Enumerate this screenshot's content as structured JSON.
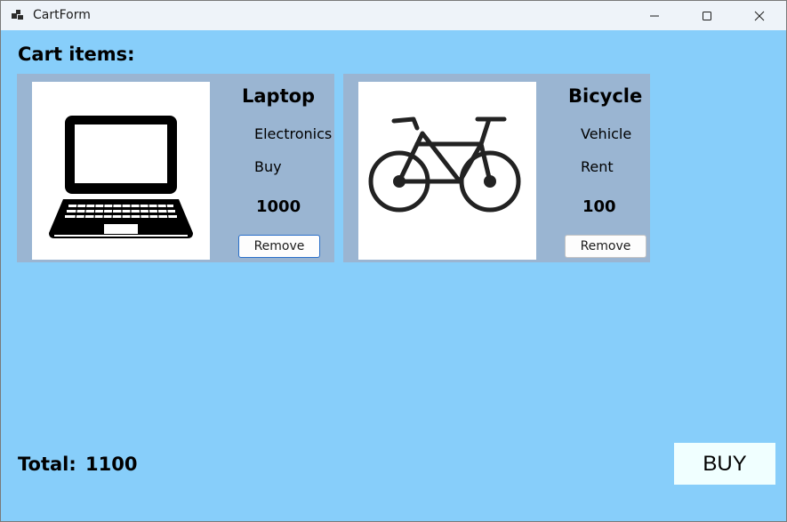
{
  "window": {
    "title": "CartForm",
    "icon": "app-form-icon",
    "controls": [
      "minimize-icon",
      "maximize-icon",
      "close-icon"
    ]
  },
  "cart": {
    "heading": "Cart items:",
    "items": [
      {
        "name": "Laptop",
        "category": "Electronics",
        "type": "Buy",
        "price": "1000",
        "image": "laptop-icon",
        "remove_label": "Remove"
      },
      {
        "name": "Bicycle",
        "category": "Vehicle",
        "type": "Rent",
        "price": "100",
        "image": "bicycle-icon",
        "remove_label": "Remove"
      }
    ]
  },
  "footer": {
    "total_label": "Total:",
    "total_value": "1100",
    "buy_label": "BUY"
  },
  "colors": {
    "background": "#87cefa",
    "card": "#9ab5d2",
    "buy_button": "#f0ffff"
  }
}
